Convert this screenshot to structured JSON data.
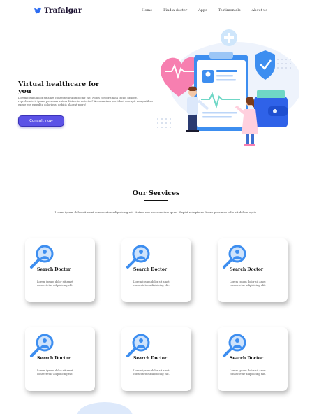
{
  "brand": {
    "name": "Trafalgar"
  },
  "nav": {
    "links": [
      "Home",
      "Find a doctor",
      "Apps",
      "Testimonials",
      "About us"
    ]
  },
  "hero": {
    "title": "Virtual healthcare for you",
    "text": "Lorem ipsum dolor sit amet consectetur adipisicing elit. Nobis corporis nihil facilis ratione, reprehenderit ipsum possimus autem distinctio delectus? Accusantium provident corrupti voluptatibus eaque eos expedita doloribus, debitis placeat porro!",
    "button": "Consult now"
  },
  "services": {
    "title": "Our Services",
    "subtitle": "Lorem ipsum dolor sit amet consectetur adipisicing elit. Autem nos accusantium quasi. Sapiet voluptates libero possimus odio sit dolore optio.",
    "cards": [
      {
        "title": "Search Doctor",
        "text": "Lorem ipsum dolor sit amet consectetur adipisicing elit."
      },
      {
        "title": "Search Doctor",
        "text": "Lorem ipsum dolor sit amet consectetur adipisicing elit."
      },
      {
        "title": "Search Doctor",
        "text": "Lorem ipsum dolor sit amet consectetur adipisicing elit."
      },
      {
        "title": "Search Doctor",
        "text": "Lorem ipsum dolor sit amet consectetur adipisicing elit."
      },
      {
        "title": "Search Doctor",
        "text": "Lorem ipsum dolor sit amet consectetur adipisicing elit."
      },
      {
        "title": "Search Doctor",
        "text": "Lorem ipsum dolor sit amet consectetur adipisicing elit."
      }
    ]
  },
  "icons": {
    "logo": "bird-logo-icon",
    "card": "search-doctor-icon"
  },
  "colors": {
    "primary": "#5b52e6",
    "icon_blue": "#3d8ef0",
    "heart": "#f77fb0",
    "text_dark": "#1f1534"
  }
}
